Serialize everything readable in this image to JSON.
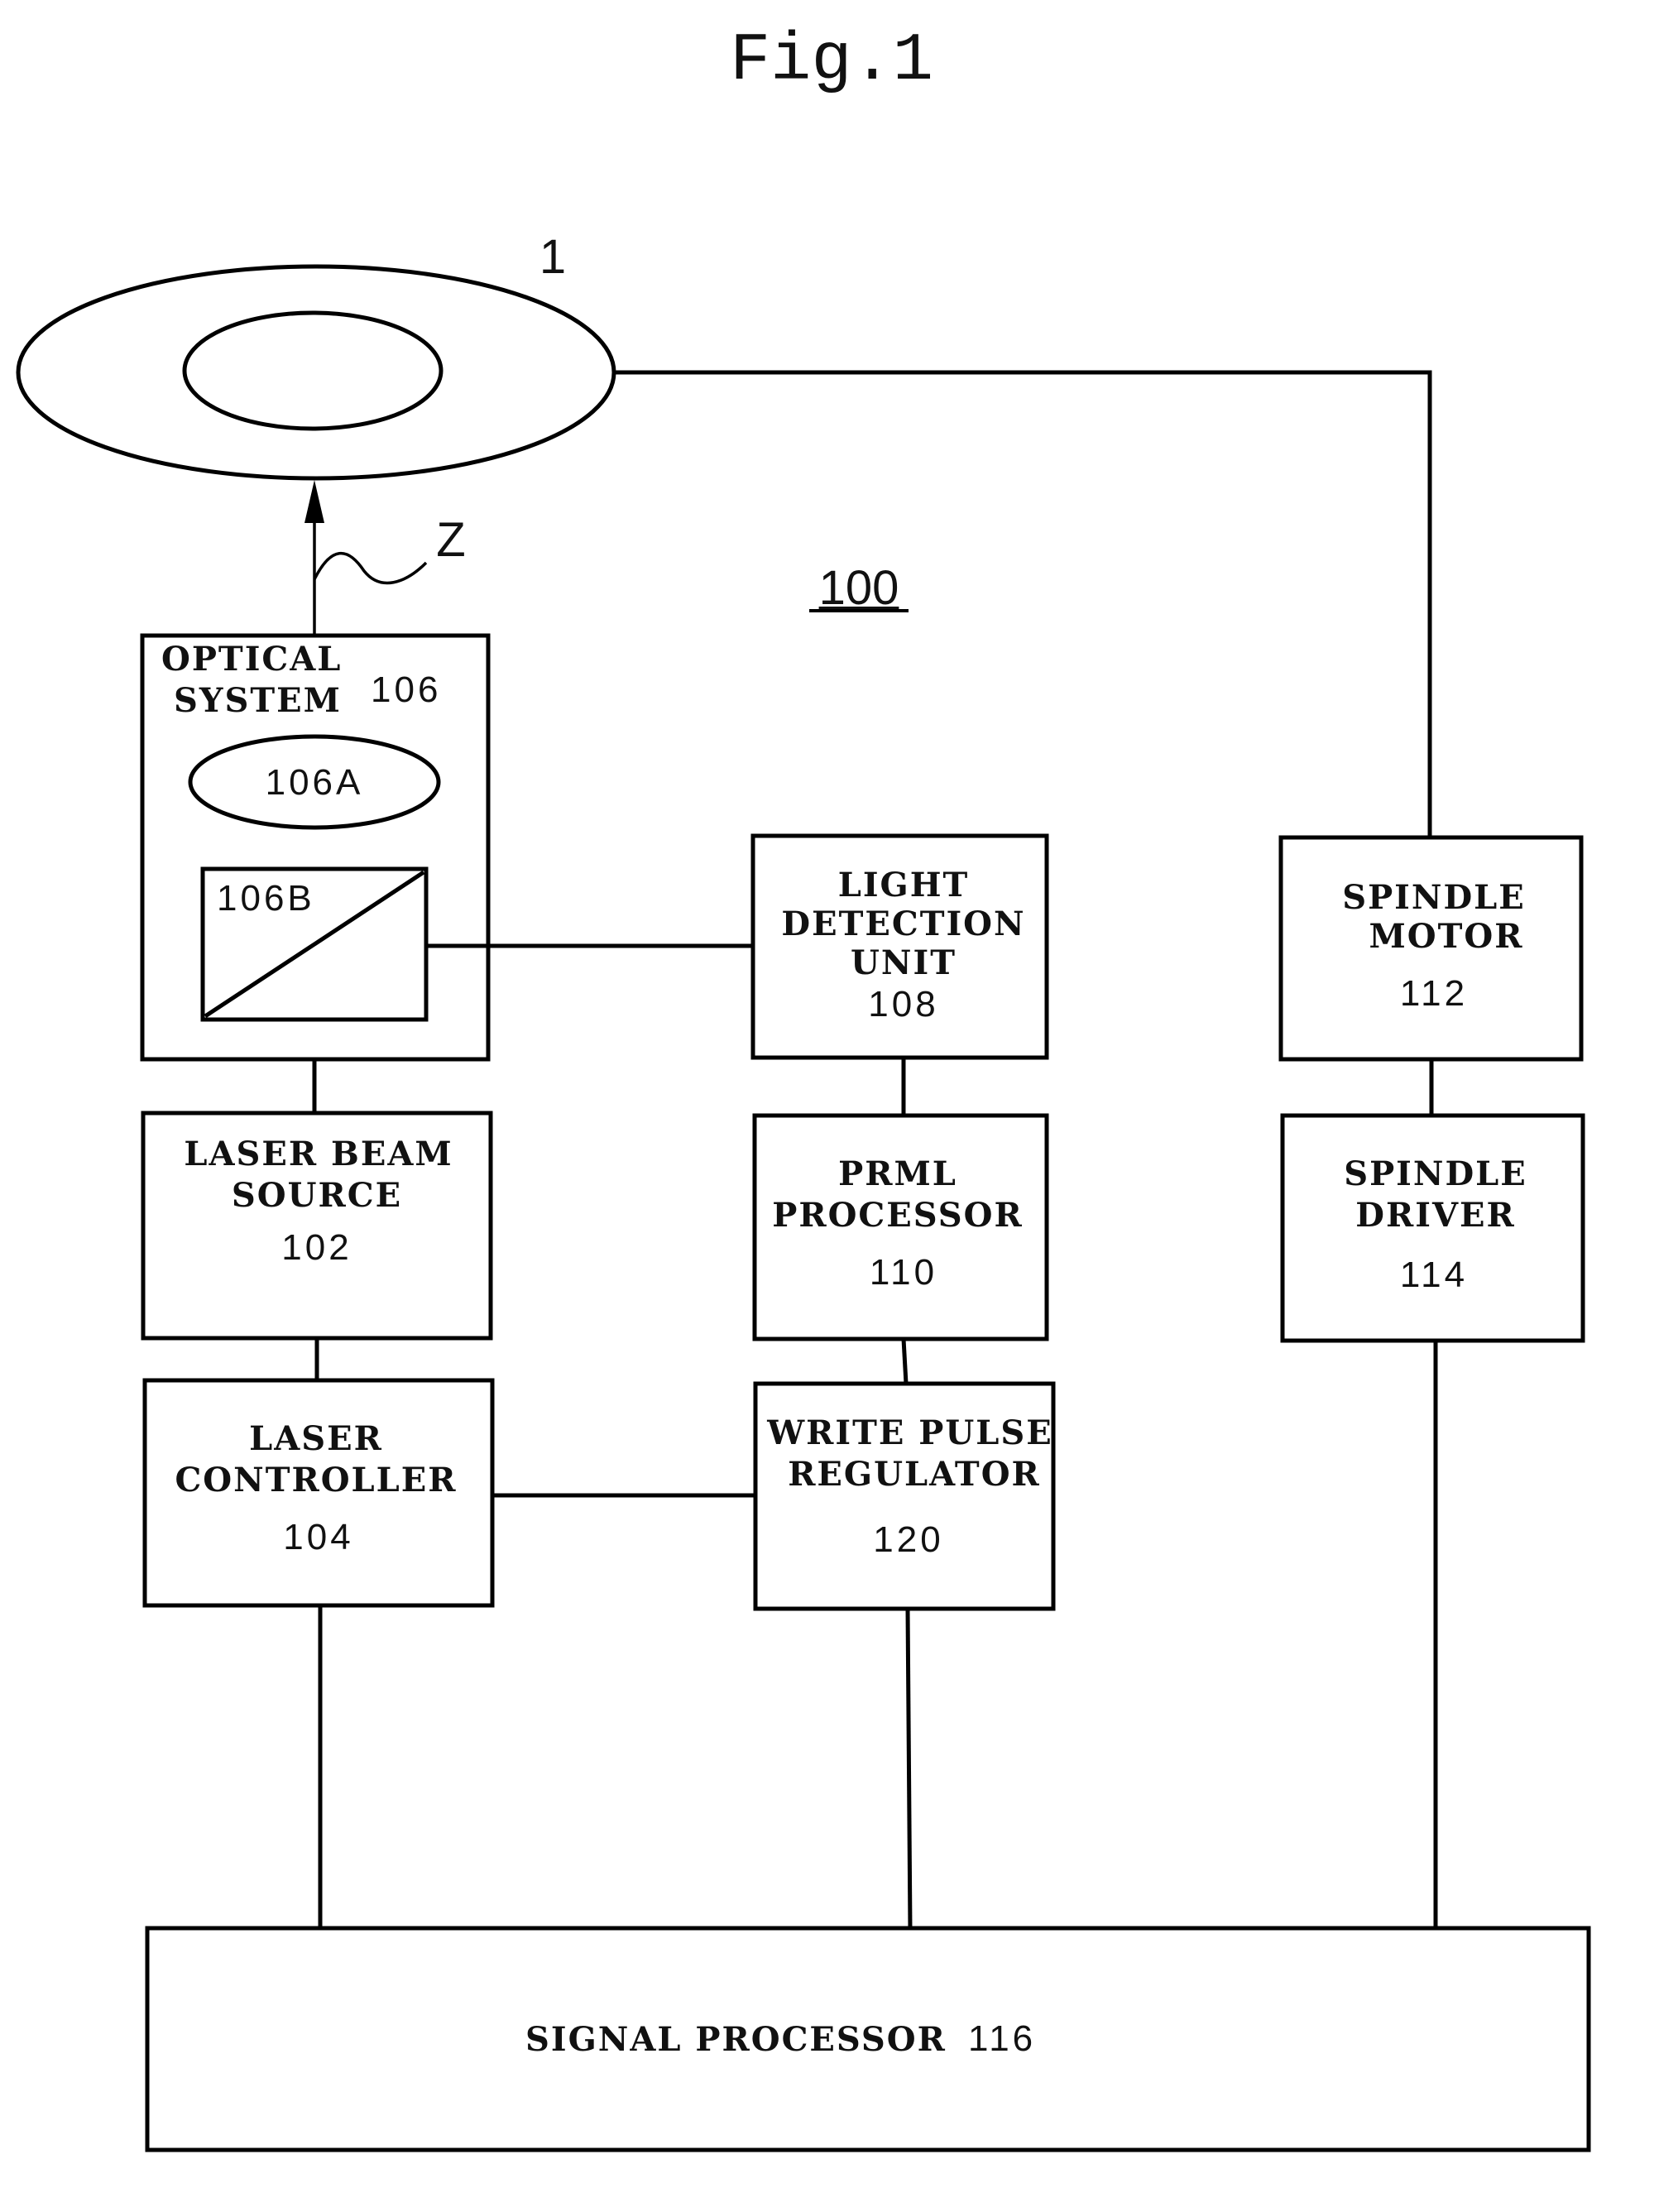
{
  "figure": {
    "title": "Fig.1",
    "system_ref": "100",
    "disc_ref": "1",
    "beam_ref": "Z"
  },
  "blocks": {
    "optical_system": {
      "line1": "OPTICAL",
      "line2": "SYSTEM",
      "ref": "106",
      "lens_ref": "106A",
      "splitter_ref": "106B"
    },
    "light_detection": {
      "line1": "LIGHT",
      "line2": "DETECTION",
      "line3": "UNIT",
      "ref": "108"
    },
    "spindle_motor": {
      "line1": "SPINDLE",
      "line2": "MOTOR",
      "ref": "112"
    },
    "laser_beam_source": {
      "line1": "LASER BEAM",
      "line2": "SOURCE",
      "ref": "102"
    },
    "prml_processor": {
      "line1": "PRML",
      "line2": "PROCESSOR",
      "ref": "110"
    },
    "spindle_driver": {
      "line1": "SPINDLE",
      "line2": "DRIVER",
      "ref": "114"
    },
    "laser_controller": {
      "line1": "LASER",
      "line2": "CONTROLLER",
      "ref": "104"
    },
    "write_pulse_regulator": {
      "line1": "WRITE PULSE",
      "line2": "REGULATOR",
      "ref": "120"
    },
    "signal_processor": {
      "label": "SIGNAL PROCESSOR",
      "ref": "116"
    }
  },
  "connections": [
    [
      "optical_system",
      "disc",
      "beam Z (arrow)"
    ],
    [
      "disc",
      "spindle_motor"
    ],
    [
      "optical_system",
      "light_detection"
    ],
    [
      "optical_system",
      "laser_beam_source"
    ],
    [
      "laser_beam_source",
      "laser_controller"
    ],
    [
      "light_detection",
      "prml_processor"
    ],
    [
      "prml_processor",
      "write_pulse_regulator"
    ],
    [
      "laser_controller",
      "write_pulse_regulator"
    ],
    [
      "spindle_motor",
      "spindle_driver"
    ],
    [
      "laser_controller",
      "signal_processor"
    ],
    [
      "write_pulse_regulator",
      "signal_processor"
    ],
    [
      "spindle_driver",
      "signal_processor"
    ]
  ]
}
